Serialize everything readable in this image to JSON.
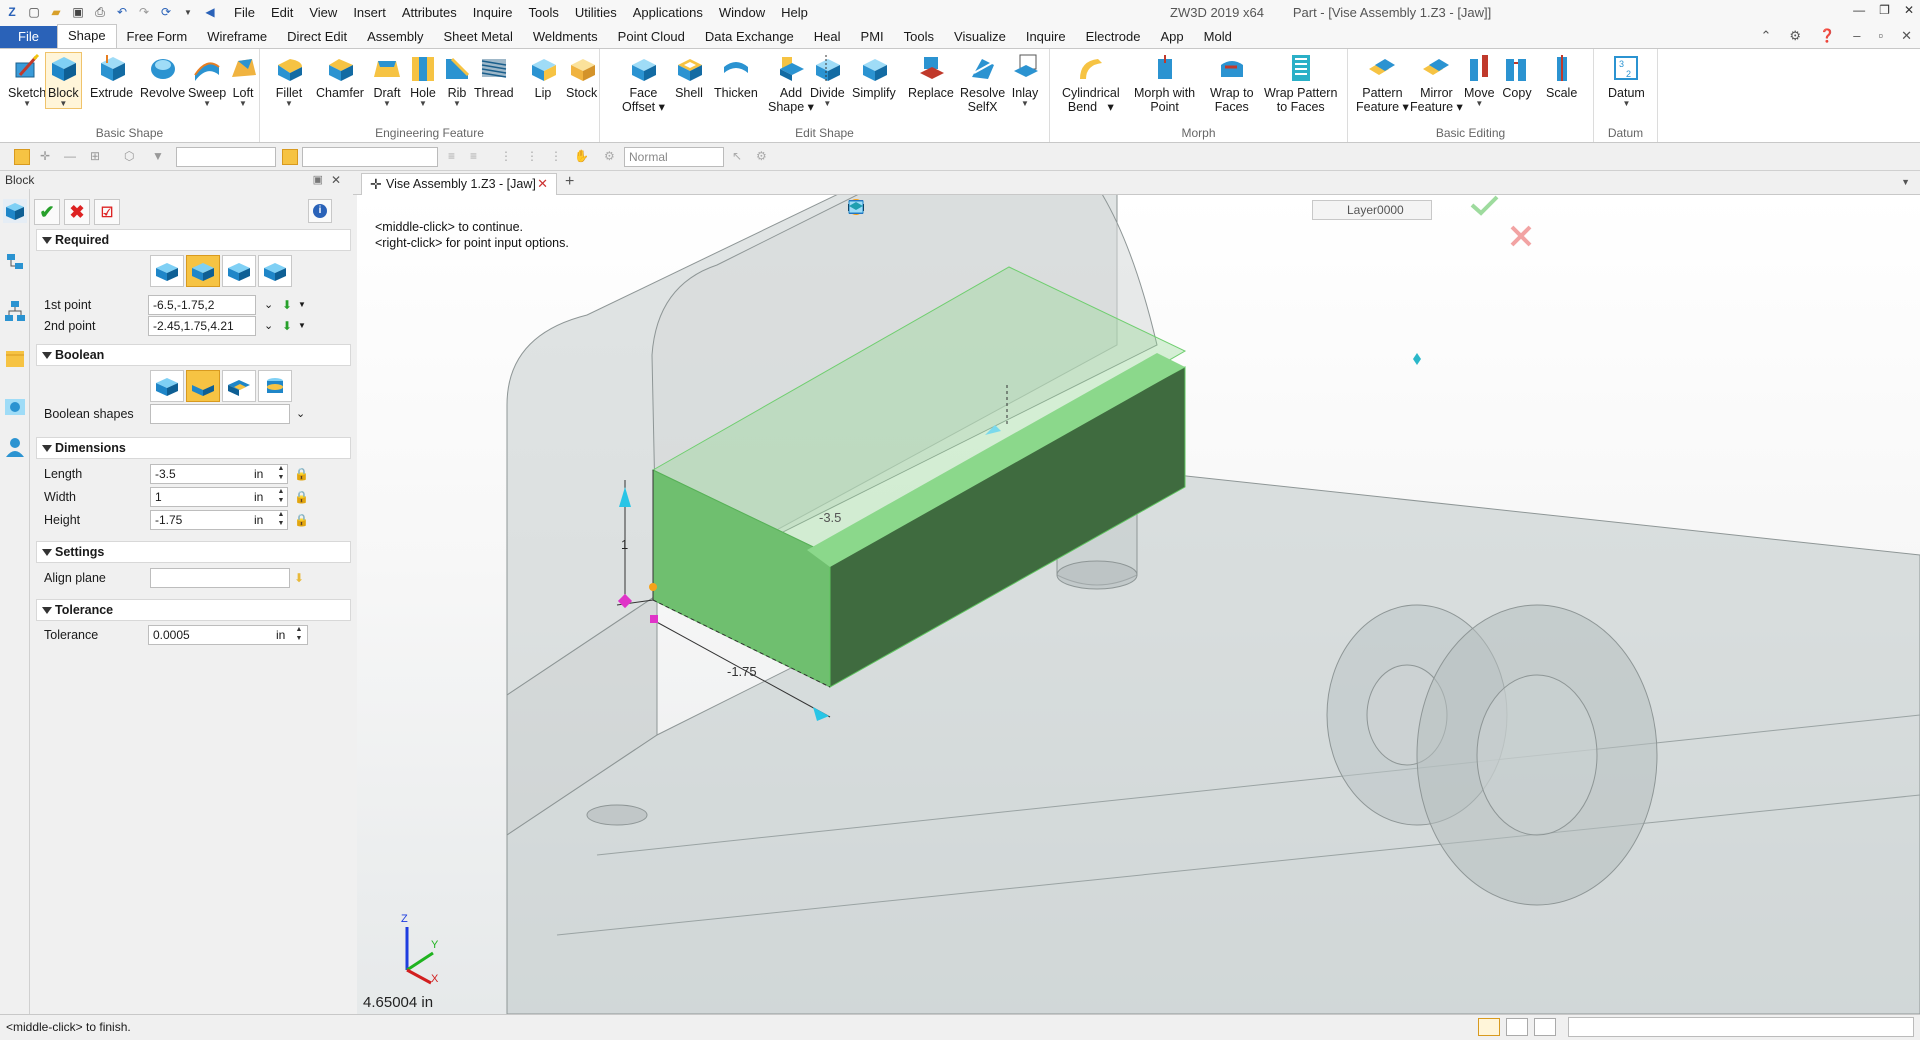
{
  "app": {
    "title": "ZW3D 2019  x64",
    "document_title": "Part - [Vise Assembly 1.Z3 - [Jaw]]"
  },
  "menu": [
    "File",
    "Edit",
    "View",
    "Insert",
    "Attributes",
    "Inquire",
    "Tools",
    "Utilities",
    "Applications",
    "Window",
    "Help"
  ],
  "ribbon_tabs": [
    "File",
    "Shape",
    "Free Form",
    "Wireframe",
    "Direct Edit",
    "Assembly",
    "Sheet Metal",
    "Weldments",
    "Point Cloud",
    "Data Exchange",
    "Heal",
    "PMI",
    "Tools",
    "Visualize",
    "Inquire",
    "Electrode",
    "App",
    "Mold"
  ],
  "active_tab": "Shape",
  "ribbon_groups": {
    "basic_shape": {
      "label": "Basic Shape",
      "buttons": [
        "Sketch",
        "Block",
        "Extrude",
        "Revolve",
        "Sweep",
        "Loft"
      ]
    },
    "engineering_feature": {
      "label": "Engineering Feature",
      "buttons": [
        "Fillet",
        "Chamfer",
        "Draft",
        "Hole",
        "Rib",
        "Thread",
        "Lip",
        "Stock"
      ]
    },
    "edit_shape": {
      "label": "Edit Shape",
      "buttons": [
        "Face Offset",
        "Shell",
        "Thicken",
        "Add Shape",
        "Divide",
        "Simplify",
        "Replace",
        "Resolve SelfX",
        "Inlay"
      ]
    },
    "morph": {
      "label": "Morph",
      "buttons": [
        "Cylindrical Bend",
        "Morph with Point",
        "Wrap to Faces",
        "Wrap Pattern to Faces"
      ]
    },
    "basic_editing": {
      "label": "Basic Editing",
      "buttons": [
        "Pattern Feature",
        "Mirror Feature",
        "Move",
        "Copy",
        "Scale"
      ]
    },
    "datum": {
      "label": "Datum",
      "buttons": [
        "Datum"
      ]
    }
  },
  "toolbar": {
    "render_mode": "Normal"
  },
  "panel": {
    "title": "Block",
    "sections": {
      "required": "Required",
      "boolean": "Boolean",
      "dimensions": "Dimensions",
      "settings": "Settings",
      "tolerance": "Tolerance"
    },
    "fields": {
      "first_point_label": "1st point",
      "first_point_value": "-6.5,-1.75,2",
      "second_point_label": "2nd point",
      "second_point_value": "-2.45,1.75,4.21",
      "boolean_shapes_label": "Boolean shapes",
      "boolean_shapes_value": "",
      "length_label": "Length",
      "length_value": "-3.5",
      "length_unit": "in",
      "width_label": "Width",
      "width_value": "1",
      "width_unit": "in",
      "height_label": "Height",
      "height_value": "-1.75",
      "height_unit": "in",
      "align_plane_label": "Align plane",
      "align_plane_value": "",
      "tolerance_label": "Tolerance",
      "tolerance_value": "0.0005",
      "tolerance_unit": "in"
    }
  },
  "doc_tab": {
    "label": "Vise Assembly 1.Z3 - [Jaw]"
  },
  "viewport": {
    "prompt_line1": "<middle-click> to continue.",
    "prompt_line2": "<right-click> for point input options.",
    "layer": "Layer0000",
    "measurement": "4.65004 in",
    "dim_length": "-3.5",
    "dim_width": "1",
    "dim_height": "-1.75",
    "axis_x": "X",
    "axis_y": "Y",
    "axis_z": "Z",
    "colors": {
      "preview_top": "#8bd88b",
      "preview_front": "#3f6b3f",
      "preview_side": "#6fbf6f",
      "part_gray": "#c9cfcf"
    }
  },
  "status": {
    "message": "<middle-click> to finish."
  }
}
